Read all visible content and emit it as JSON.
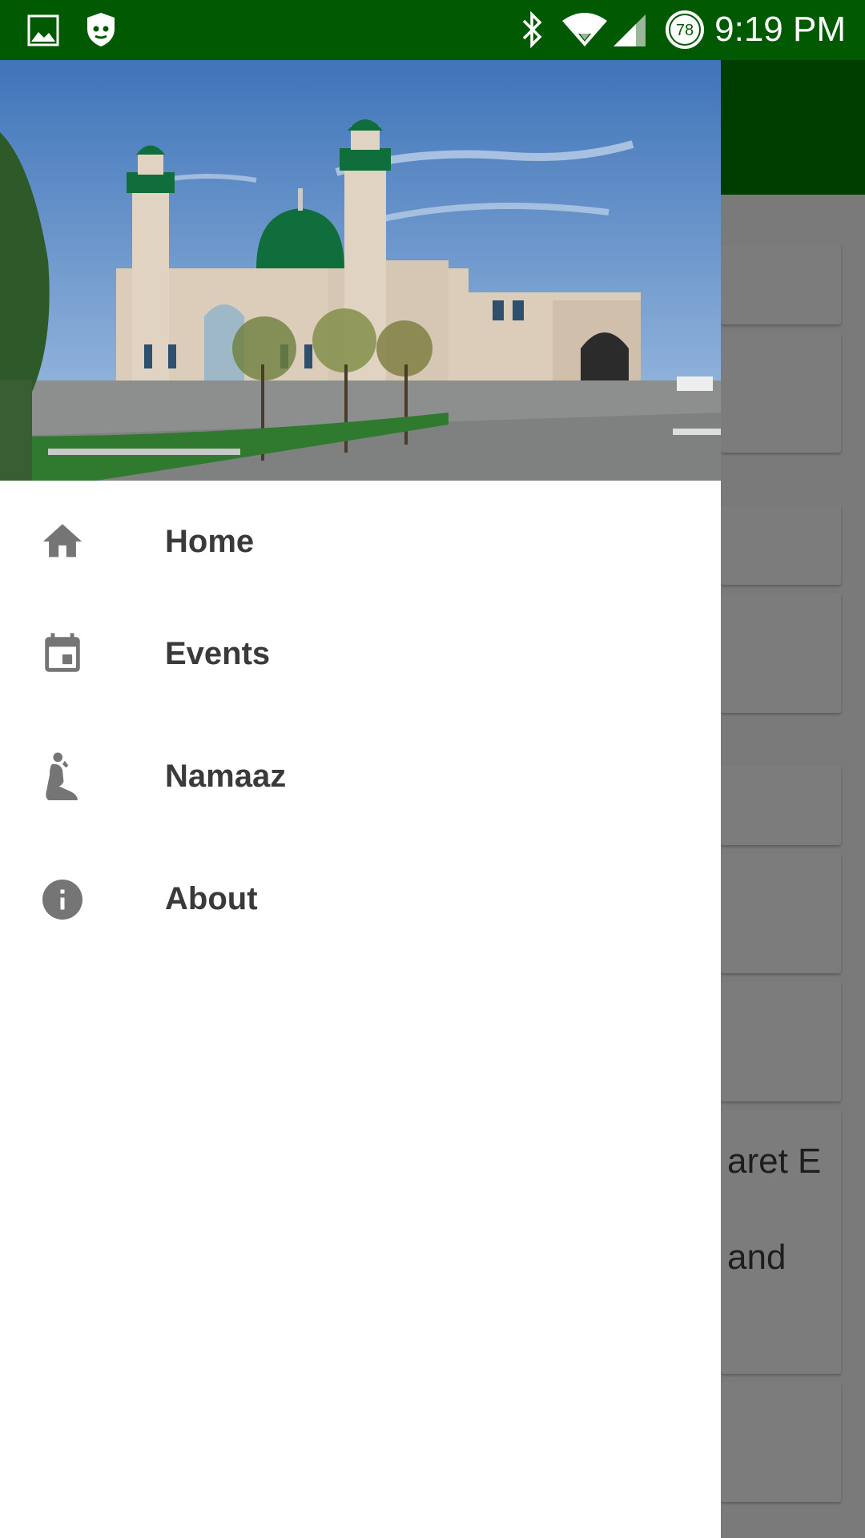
{
  "status_bar": {
    "time": "9:19 PM",
    "battery": "78",
    "icons": [
      "image-icon",
      "shield-icon",
      "bluetooth-icon",
      "wifi-icon",
      "signal-icon",
      "battery-icon"
    ]
  },
  "drawer": {
    "header_image": "mosque-photo",
    "items": [
      {
        "label": "Home",
        "icon": "home-icon"
      },
      {
        "label": "Events",
        "icon": "calendar-icon"
      },
      {
        "label": "Namaaz",
        "icon": "prayer-icon"
      },
      {
        "label": "About",
        "icon": "info-icon"
      }
    ]
  },
  "background_content": {
    "text_1": "aret E",
    "text_2": "and"
  },
  "colors": {
    "status_bar": "#015a01",
    "toolbar": "#003e00",
    "icon_gray": "#757575",
    "label_text": "#3a3a3a"
  }
}
